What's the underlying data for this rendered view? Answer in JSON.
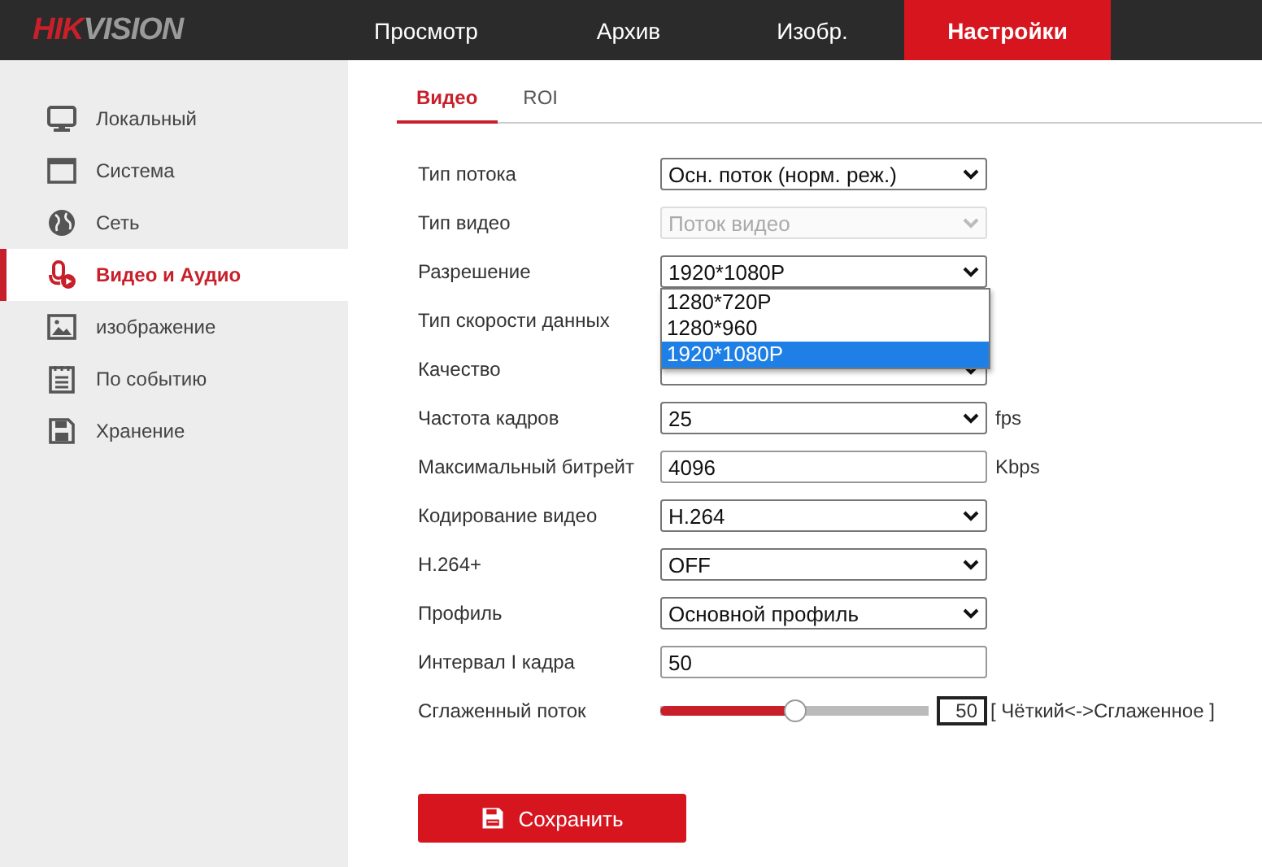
{
  "header": {
    "logo": "HIKVISION",
    "nav": [
      {
        "label": "Просмотр",
        "selected": false
      },
      {
        "label": "Архив",
        "selected": false
      },
      {
        "label": "Изобр.",
        "selected": false
      },
      {
        "label": "Настройки",
        "selected": true
      }
    ]
  },
  "sidebar": {
    "items": [
      {
        "label": "Локальный",
        "selected": false
      },
      {
        "label": "Система",
        "selected": false
      },
      {
        "label": "Сеть",
        "selected": false
      },
      {
        "label": "Видео и Аудио",
        "selected": true
      },
      {
        "label": "изображение",
        "selected": false
      },
      {
        "label": "По событию",
        "selected": false
      },
      {
        "label": "Хранение",
        "selected": false
      }
    ]
  },
  "tabs": [
    {
      "label": "Видео",
      "selected": true
    },
    {
      "label": "ROI",
      "selected": false
    }
  ],
  "form": [
    {
      "kind": "select",
      "label": "Тип потока",
      "value": "Осн. поток (норм. реж.)",
      "disabled": false
    },
    {
      "kind": "select",
      "label": "Тип видео",
      "value": "Поток видео",
      "disabled": true
    },
    {
      "kind": "select",
      "label": "Разрешение",
      "value": "1920*1080P",
      "disabled": false,
      "expanded": true,
      "options": [
        {
          "label": "1280*720P",
          "selected": false
        },
        {
          "label": "1280*960",
          "selected": false
        },
        {
          "label": "1920*1080P",
          "selected": true
        }
      ]
    },
    {
      "kind": "hidden",
      "label": "Тип скорости данных"
    },
    {
      "kind": "select",
      "label": "Качество",
      "disabled": false
    },
    {
      "kind": "select",
      "label": "Частота кадров",
      "value": "25",
      "disabled": false,
      "unit": "fps"
    },
    {
      "kind": "input",
      "label": "Максимальный битрейт",
      "value": "4096",
      "unit": "Kbps"
    },
    {
      "kind": "select",
      "label": "Кодирование видео",
      "value": "H.264",
      "disabled": false
    },
    {
      "kind": "select",
      "label": "H.264+",
      "value": "OFF",
      "disabled": false
    },
    {
      "kind": "select",
      "label": "Профиль",
      "value": "Основной профиль",
      "disabled": false
    },
    {
      "kind": "input",
      "label": "Интервал I кадра",
      "value": "50"
    },
    {
      "kind": "slider",
      "label": "Сглаженный поток",
      "level": 0.5,
      "value": "50",
      "unit": "[ Чёткий<->Сглаженное ]"
    }
  ],
  "save_button": "Сохранить"
}
